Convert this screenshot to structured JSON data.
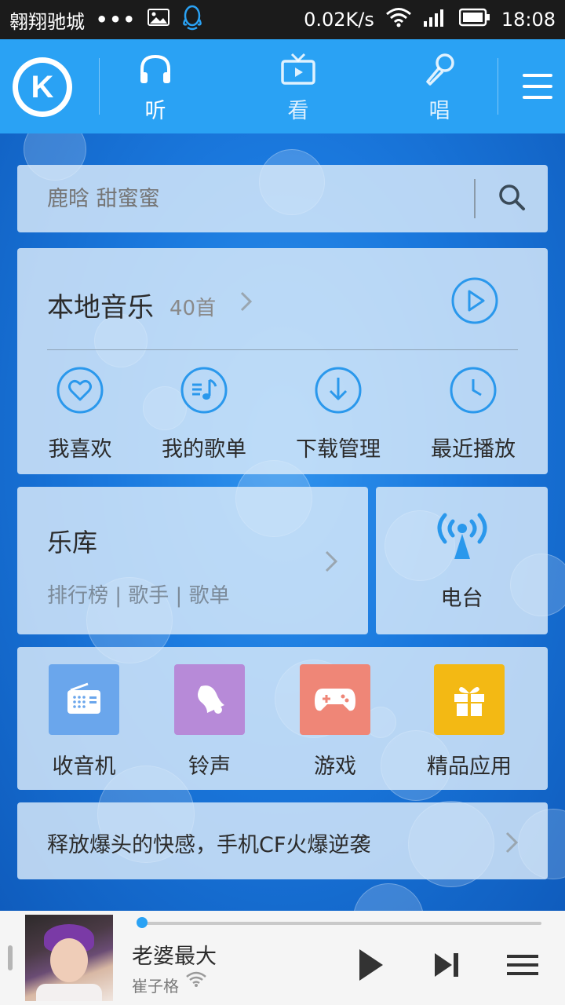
{
  "status_bar": {
    "carrier": "翱翔驰城",
    "dots": "•••",
    "speed": "0.02K/s",
    "time": "18:08",
    "icons": [
      "image-icon",
      "qq-icon",
      "wifi-icon",
      "signal-icon",
      "battery-icon"
    ]
  },
  "top_nav": {
    "logo_letter": "K",
    "tabs": [
      {
        "label": "听",
        "icon": "headphones-icon",
        "active": true
      },
      {
        "label": "看",
        "icon": "tv-icon",
        "active": false
      },
      {
        "label": "唱",
        "icon": "microphone-icon",
        "active": false
      }
    ],
    "menu_icon": "menu-icon"
  },
  "search": {
    "placeholder": "鹿晗 甜蜜蜜",
    "icon": "search-icon"
  },
  "local_music": {
    "title": "本地音乐",
    "count": "40首",
    "quick_links": [
      {
        "label": "我喜欢",
        "icon": "heart-icon"
      },
      {
        "label": "我的歌单",
        "icon": "playlist-icon"
      },
      {
        "label": "下载管理",
        "icon": "download-icon"
      },
      {
        "label": "最近播放",
        "icon": "clock-icon"
      }
    ]
  },
  "library": {
    "title": "乐库",
    "subtitle": "排行榜 | 歌手 | 歌单"
  },
  "radio": {
    "label": "电台",
    "icon": "broadcast-icon"
  },
  "apps": [
    {
      "label": "收音机",
      "icon": "radio-icon",
      "color": "#6aa6ec"
    },
    {
      "label": "铃声",
      "icon": "bell-icon",
      "color": "#b78ad8"
    },
    {
      "label": "游戏",
      "icon": "gamepad-icon",
      "color": "#ef8677"
    },
    {
      "label": "精品应用",
      "icon": "gift-icon",
      "color": "#f3b914"
    }
  ],
  "promo": {
    "text": "释放爆头的快感，手机CF火爆逆袭"
  },
  "player": {
    "song": "老婆最大",
    "artist": "崔子格",
    "progress": 0.0,
    "accent": "#2aa2f4"
  },
  "colors": {
    "nav_blue": "#2aa2f4",
    "accent": "#2aa2f4"
  }
}
